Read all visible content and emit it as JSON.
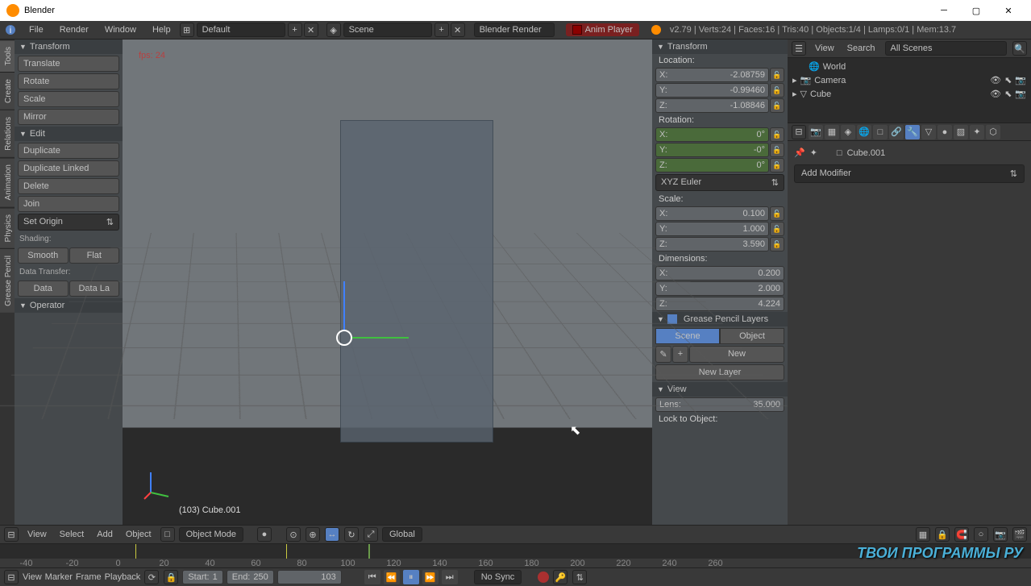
{
  "titlebar": {
    "title": "Blender"
  },
  "menubar": {
    "file": "File",
    "render": "Render",
    "window": "Window",
    "help": "Help",
    "layout": "Default",
    "scene": "Scene",
    "engine": "Blender Render",
    "anim_player": "Anim Player",
    "stats": "v2.79 | Verts:24 | Faces:16 | Tris:40 | Objects:1/4 | Lamps:0/1 | Mem:13.7"
  },
  "spine": {
    "tools": "Tools",
    "create": "Create",
    "relations": "Relations",
    "animation": "Animation",
    "physics": "Physics",
    "grease": "Grease Pencil"
  },
  "tools": {
    "transform_header": "Transform",
    "translate": "Translate",
    "rotate": "Rotate",
    "scale": "Scale",
    "mirror": "Mirror",
    "edit_header": "Edit",
    "duplicate": "Duplicate",
    "duplicate_linked": "Duplicate Linked",
    "delete": "Delete",
    "join": "Join",
    "set_origin": "Set Origin",
    "shading_label": "Shading:",
    "smooth": "Smooth",
    "flat": "Flat",
    "data_transfer_label": "Data Transfer:",
    "data": "Data",
    "data_la": "Data La",
    "operator_header": "Operator"
  },
  "viewport": {
    "fps": "fps: 24",
    "object_label": "(103) Cube.001"
  },
  "npanel": {
    "transform_header": "Transform",
    "location_label": "Location:",
    "loc": {
      "x_label": "X:",
      "x": "-2.08759",
      "y_label": "Y:",
      "y": "-0.99460",
      "z_label": "Z:",
      "z": "-1.08846"
    },
    "rotation_label": "Rotation:",
    "rot": {
      "x_label": "X:",
      "x": "0°",
      "y_label": "Y:",
      "y": "-0°",
      "z_label": "Z:",
      "z": "0°"
    },
    "rot_mode": "XYZ Euler",
    "scale_label": "Scale:",
    "scl": {
      "x_label": "X:",
      "x": "0.100",
      "y_label": "Y:",
      "y": "1.000",
      "z_label": "Z:",
      "z": "3.590"
    },
    "dimensions_label": "Dimensions:",
    "dim": {
      "x_label": "X:",
      "x": "0.200",
      "y_label": "Y:",
      "y": "2.000",
      "z_label": "Z:",
      "z": "4.224"
    },
    "gp_header": "Grease Pencil Layers",
    "gp_scene": "Scene",
    "gp_object": "Object",
    "gp_new": "New",
    "gp_new_layer": "New Layer",
    "view_header": "View",
    "lens_label": "Lens:",
    "lens": "35.000",
    "lock_label": "Lock to Object:"
  },
  "outliner": {
    "view": "View",
    "search": "Search",
    "scenes": "All Scenes",
    "world": "World",
    "camera": "Camera",
    "cube": "Cube"
  },
  "props": {
    "object_name": "Cube.001",
    "add_modifier": "Add Modifier"
  },
  "vp_header": {
    "view": "View",
    "select": "Select",
    "add": "Add",
    "object": "Object",
    "mode": "Object Mode",
    "orientation": "Global"
  },
  "timeline": {
    "ticks": [
      "-40",
      "-20",
      "0",
      "20",
      "40",
      "60",
      "80",
      "100",
      "120",
      "140",
      "160",
      "180",
      "200",
      "220",
      "240",
      "260"
    ]
  },
  "tl_footer": {
    "view": "View",
    "marker": "Marker",
    "frame": "Frame",
    "playback": "Playback",
    "start_label": "Start:",
    "start": "1",
    "end_label": "End:",
    "end": "250",
    "current": "103",
    "sync": "No Sync"
  },
  "watermark": "ТВОИ ПРОГРАММЫ РУ"
}
